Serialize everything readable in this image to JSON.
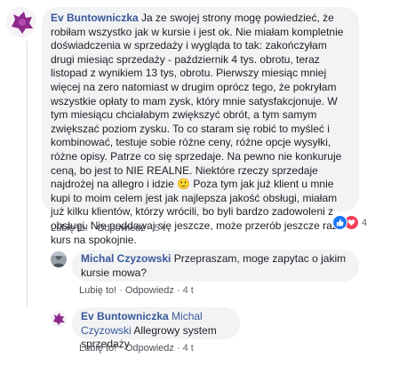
{
  "comments": [
    {
      "author": "Ev Buntowniczka",
      "text": "Ja ze swojej strony mogę powiedzieć, że robiłam wszystko jak w kursie i jest ok. Nie miałam kompletnie doświadczenia w sprzedaży i wygląda to tak: zakończyłam drugi miesiąc sprzedaży - październik 4 tys. obrotu, teraz listopad z wynikiem 13 tys, obrotu. Pierwszy miesiąc mniej więcej na zero natomiast w drugim oprócz tego, że pokryłam wszystkie opłaty to mam zysk, który mnie satysfakcjonuje. W tym miesiącu chciałabym zwiększyć obrót, a tym samym zwiększać poziom zysku. To co staram się robić to myśleć i kombinować, testuje sobie różne ceny, różne opcje wysyłki, różne opisy. Patrze co się sprzedaje. Na pewno nie konkuruje ceną, bo jest to NIE REALNE. Niektóre rzeczy sprzedaje najdrożej na allegro i idzie ",
      "emoji": "🙂",
      "text_after": " Poza tym jak już klient u mnie kupi to moim celem jest jak najlepsza jakość obsługi, miałam już kilku klientów, którzy wrócili, bo byli bardzo zadowoleni z obsługi. Nie poddawaj się jeszcze, może przerób jeszcze raz kurs na spokojnie.",
      "like": "Lubię to!",
      "reply": "Odpowiedz",
      "time": "5 t",
      "reaction_count": "4"
    },
    {
      "author": "Michal Czyzowski",
      "text": "Przepraszam, moge zapytac o jakim kursie mowa?",
      "like": "Lubię to!",
      "reply": "Odpowiedz",
      "time": "4 t"
    },
    {
      "author": "Ev Buntowniczka",
      "mention": "Michal Czyzowski",
      "text": "Allegrowy system sprzedaży",
      "like": "Lubię to!",
      "reply": "Odpowiedz",
      "time": "4 t"
    }
  ],
  "colors": {
    "link": "#385898",
    "bubble": "#f2f3f5",
    "like": "#1877f2",
    "love": "#f33e58"
  },
  "icons": [
    "avatar-image",
    "like-reaction-icon",
    "love-reaction-icon"
  ]
}
